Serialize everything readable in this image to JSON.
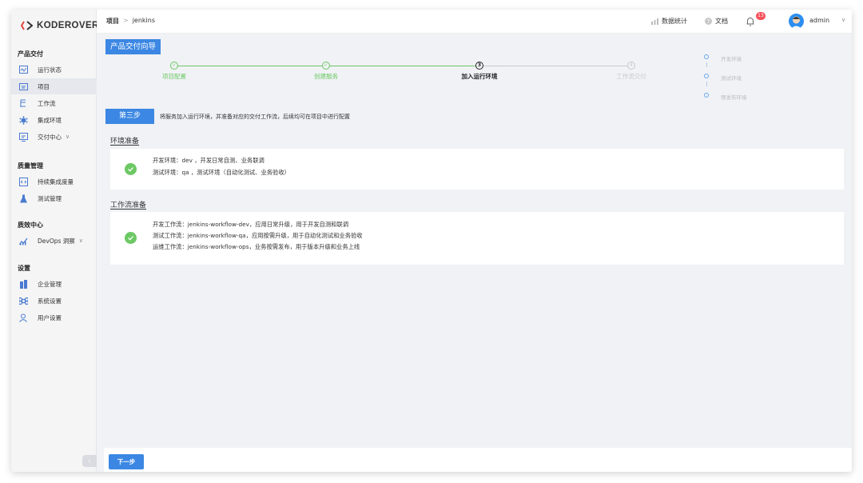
{
  "app": {
    "logo_text": "KODEROVER"
  },
  "sidebar": {
    "sections": [
      {
        "title": "产品交付",
        "items": [
          {
            "label": "运行状态",
            "icon": "monitor-icon"
          },
          {
            "label": "项目",
            "icon": "folder-icon",
            "active": true
          },
          {
            "label": "工作流",
            "icon": "workflow-icon"
          },
          {
            "label": "集成环境",
            "icon": "cluster-icon"
          },
          {
            "label": "交付中心",
            "icon": "delivery-icon",
            "dropdown": true
          }
        ]
      },
      {
        "title": "质量管理",
        "items": [
          {
            "label": "持续集成度量",
            "icon": "code-icon"
          },
          {
            "label": "测试管理",
            "icon": "flask-icon"
          }
        ]
      },
      {
        "title": "质效中心",
        "items": [
          {
            "label": "DevOps 洞察",
            "icon": "insight-icon",
            "dropdown": true
          }
        ]
      },
      {
        "title": "设置",
        "items": [
          {
            "label": "企业管理",
            "icon": "building-icon"
          },
          {
            "label": "系统设置",
            "icon": "command-icon"
          },
          {
            "label": "用户设置",
            "icon": "user-icon"
          }
        ]
      }
    ],
    "collapse_glyph": "‹"
  },
  "header": {
    "breadcrumb": {
      "root": "项目",
      "sep": ">",
      "current": "jenkins"
    },
    "stats_label": "数据统计",
    "docs_label": "文档",
    "notification_count": "13",
    "user_name": "admin"
  },
  "guide": {
    "title": "产品交付向导",
    "steps": [
      {
        "label": "项目配置",
        "state": "done",
        "mark": "✓"
      },
      {
        "label": "创建服务",
        "state": "done",
        "mark": "✓"
      },
      {
        "label": "加入运行环境",
        "state": "current",
        "mark": "3"
      },
      {
        "label": "工作流交付",
        "state": "pending",
        "mark": "4"
      }
    ],
    "envs": [
      "开发环境",
      "测试环境",
      "预发布环境"
    ],
    "step_tag": "第三步",
    "step_desc": "将服务加入运行环境，并准备对应的交付工作流，后续均可在项目中进行配置",
    "env_section": {
      "title": "环境准备",
      "lines": [
        "开发环境：dev ，开发日常自测、业务联调",
        "测试环境：qa ，测试环境（自动化测试、业务验收）"
      ]
    },
    "workflow_section": {
      "title": "工作流准备",
      "lines": [
        "开发工作流：jenkins-workflow-dev，应用日常升级，用于开发自测和联调",
        "测试工作流：jenkins-workflow-qa，应用按需升级，用于自动化测试和业务验收",
        "运维工作流：jenkins-workflow-ops，业务按需发布，用于版本升级和业务上线"
      ]
    },
    "next_label": "下一步"
  },
  "colors": {
    "primary": "#3b87e3",
    "success": "#6cc864",
    "badge": "#f5505a"
  }
}
